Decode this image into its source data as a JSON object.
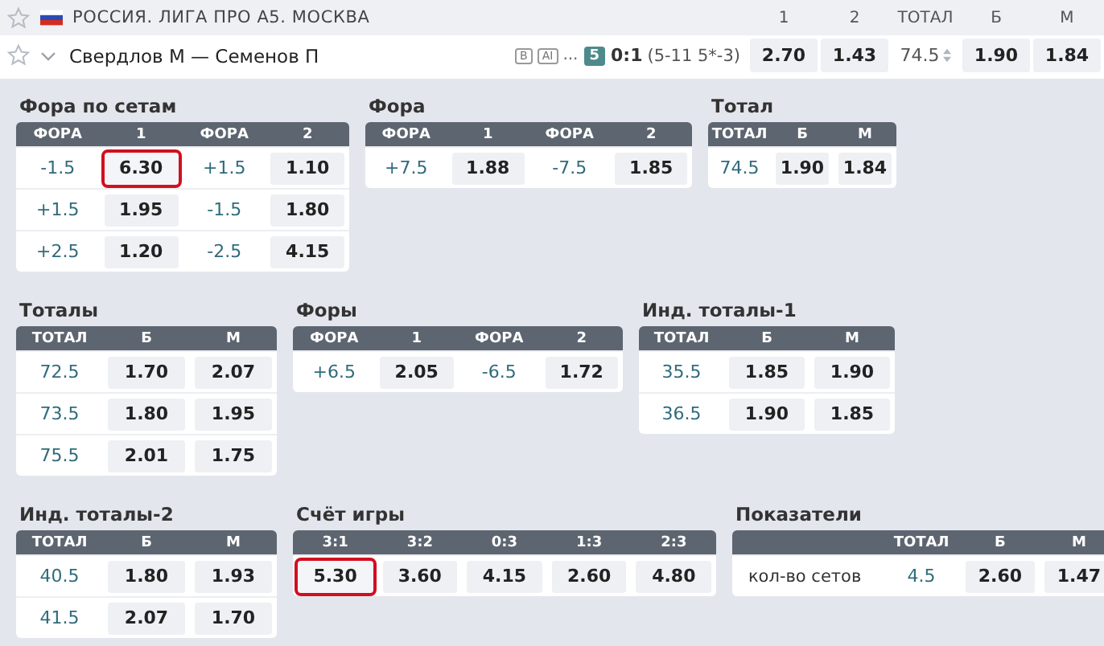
{
  "league": {
    "title": "РОССИЯ. ЛИГА ПРО А5. МОСКВА",
    "columns": [
      "1",
      "2",
      "ТОТАЛ",
      "Б",
      "М"
    ]
  },
  "match": {
    "players": "Свердлов М — Семенов П",
    "tags": [
      "B",
      "AI"
    ],
    "more": "...",
    "set": "5",
    "score": "0:1",
    "details": "(5-11 5*-3)",
    "cells": [
      {
        "kind": "odd",
        "text": "2.70"
      },
      {
        "kind": "odd",
        "text": "1.43"
      },
      {
        "kind": "param",
        "text": "74.5"
      },
      {
        "kind": "odd",
        "text": "1.90"
      },
      {
        "kind": "odd",
        "text": "1.84"
      }
    ]
  },
  "market_rows": [
    [
      {
        "title": "Фора по сетам",
        "columns": [
          "ФОРА",
          "1",
          "ФОРА",
          "2"
        ],
        "rows": [
          [
            {
              "kind": "param",
              "text": "-1.5"
            },
            {
              "kind": "odd",
              "text": "6.30",
              "highlighted": true
            },
            {
              "kind": "param",
              "text": "+1.5"
            },
            {
              "kind": "odd",
              "text": "1.10",
              "highlighted": false
            }
          ],
          [
            {
              "kind": "param",
              "text": "+1.5"
            },
            {
              "kind": "odd",
              "text": "1.95",
              "highlighted": false
            },
            {
              "kind": "param",
              "text": "-1.5"
            },
            {
              "kind": "odd",
              "text": "1.80",
              "highlighted": false
            }
          ],
          [
            {
              "kind": "param",
              "text": "+2.5"
            },
            {
              "kind": "odd",
              "text": "1.20",
              "highlighted": false
            },
            {
              "kind": "param",
              "text": "-2.5"
            },
            {
              "kind": "odd",
              "text": "4.15",
              "highlighted": false
            }
          ]
        ]
      },
      {
        "title": "Фора",
        "columns": [
          "ФОРА",
          "1",
          "ФОРА",
          "2"
        ],
        "rows": [
          [
            {
              "kind": "param",
              "text": "+7.5"
            },
            {
              "kind": "odd",
              "text": "1.88",
              "highlighted": false
            },
            {
              "kind": "param",
              "text": "-7.5"
            },
            {
              "kind": "odd",
              "text": "1.85",
              "highlighted": false
            }
          ]
        ]
      },
      {
        "title": "Тотал",
        "columns": [
          "ТОТАЛ",
          "Б",
          "М"
        ],
        "rows": [
          [
            {
              "kind": "param",
              "text": "74.5"
            },
            {
              "kind": "odd",
              "text": "1.90",
              "highlighted": false
            },
            {
              "kind": "odd",
              "text": "1.84",
              "highlighted": false
            }
          ]
        ]
      }
    ],
    [
      {
        "title": "Тоталы",
        "columns": [
          "ТОТАЛ",
          "Б",
          "М"
        ],
        "rows": [
          [
            {
              "kind": "param",
              "text": "72.5"
            },
            {
              "kind": "odd",
              "text": "1.70",
              "highlighted": false
            },
            {
              "kind": "odd",
              "text": "2.07",
              "highlighted": false
            }
          ],
          [
            {
              "kind": "param",
              "text": "73.5"
            },
            {
              "kind": "odd",
              "text": "1.80",
              "highlighted": false
            },
            {
              "kind": "odd",
              "text": "1.95",
              "highlighted": false
            }
          ],
          [
            {
              "kind": "param",
              "text": "75.5"
            },
            {
              "kind": "odd",
              "text": "2.01",
              "highlighted": false
            },
            {
              "kind": "odd",
              "text": "1.75",
              "highlighted": false
            }
          ]
        ]
      },
      {
        "title": "Форы",
        "columns": [
          "ФОРА",
          "1",
          "ФОРА",
          "2"
        ],
        "rows": [
          [
            {
              "kind": "param",
              "text": "+6.5"
            },
            {
              "kind": "odd",
              "text": "2.05",
              "highlighted": false
            },
            {
              "kind": "param",
              "text": "-6.5"
            },
            {
              "kind": "odd",
              "text": "1.72",
              "highlighted": false
            }
          ]
        ]
      },
      {
        "title": "Инд. тоталы-1",
        "columns": [
          "ТОТАЛ",
          "Б",
          "М"
        ],
        "rows": [
          [
            {
              "kind": "param",
              "text": "35.5"
            },
            {
              "kind": "odd",
              "text": "1.85",
              "highlighted": false
            },
            {
              "kind": "odd",
              "text": "1.90",
              "highlighted": false
            }
          ],
          [
            {
              "kind": "param",
              "text": "36.5"
            },
            {
              "kind": "odd",
              "text": "1.90",
              "highlighted": false
            },
            {
              "kind": "odd",
              "text": "1.85",
              "highlighted": false
            }
          ]
        ]
      }
    ],
    [
      {
        "title": "Инд. тоталы-2",
        "columns": [
          "ТОТАЛ",
          "Б",
          "М"
        ],
        "rows": [
          [
            {
              "kind": "param",
              "text": "40.5"
            },
            {
              "kind": "odd",
              "text": "1.80",
              "highlighted": false
            },
            {
              "kind": "odd",
              "text": "1.93",
              "highlighted": false
            }
          ],
          [
            {
              "kind": "param",
              "text": "41.5"
            },
            {
              "kind": "odd",
              "text": "2.07",
              "highlighted": false
            },
            {
              "kind": "odd",
              "text": "1.70",
              "highlighted": false
            }
          ]
        ]
      },
      {
        "title": "Счёт игры",
        "columns": [
          "3:1",
          "3:2",
          "0:3",
          "1:3",
          "2:3"
        ],
        "rows": [
          [
            {
              "kind": "odd",
              "text": "5.30",
              "highlighted": true
            },
            {
              "kind": "odd",
              "text": "3.60",
              "highlighted": false
            },
            {
              "kind": "odd",
              "text": "4.15",
              "highlighted": false
            },
            {
              "kind": "odd",
              "text": "2.60",
              "highlighted": false
            },
            {
              "kind": "odd",
              "text": "4.80",
              "highlighted": false
            }
          ]
        ]
      },
      {
        "title": "Показатели",
        "columns": [
          "",
          "ТОТАЛ",
          "Б",
          "М"
        ],
        "rows": [
          [
            {
              "kind": "label",
              "text": "кол-во сетов"
            },
            {
              "kind": "param",
              "text": "4.5"
            },
            {
              "kind": "odd",
              "text": "2.60",
              "highlighted": false
            },
            {
              "kind": "odd",
              "text": "1.47",
              "highlighted": false
            }
          ]
        ]
      }
    ]
  ]
}
